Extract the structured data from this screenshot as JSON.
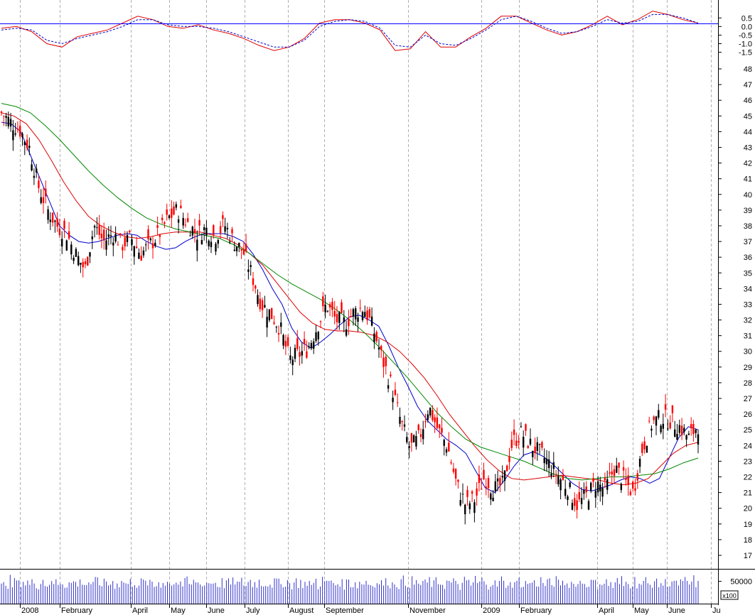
{
  "chart_data": [
    {
      "panel": "oscillator",
      "type": "line",
      "y_ticks": [
        "0.5",
        "0.0",
        "-0.5",
        "-1.0",
        "-1.5"
      ],
      "ylim": [
        -1.6,
        0.8
      ],
      "reference_line": 0,
      "series": [
        {
          "color": "#dd0000",
          "style": "solid",
          "values": [
            -0.1,
            0.0,
            -0.3,
            -1.0,
            -1.2,
            -0.6,
            -0.4,
            -0.2,
            0.2,
            0.6,
            0.4,
            0.0,
            -0.1,
            0.1,
            -0.2,
            -0.4,
            -0.7,
            -1.1,
            -1.4,
            -1.2,
            -0.7,
            0.2,
            0.4,
            0.4,
            0.2,
            -0.2,
            -1.4,
            -1.3,
            -0.3,
            -1.2,
            -1.2,
            -0.6,
            -0.1,
            0.6,
            0.6,
            0.2,
            -0.2,
            -0.5,
            -0.3,
            0.1,
            0.6,
            0.1,
            0.4,
            0.9,
            0.7,
            0.4,
            0.2
          ]
        },
        {
          "color": "#0000cc",
          "style": "dashed",
          "values": [
            -0.2,
            -0.1,
            -0.2,
            -0.8,
            -1.0,
            -0.7,
            -0.5,
            -0.3,
            0.0,
            0.4,
            0.4,
            0.1,
            0.0,
            0.0,
            -0.1,
            -0.3,
            -0.6,
            -0.9,
            -1.2,
            -1.2,
            -0.8,
            0.0,
            0.3,
            0.4,
            0.3,
            -0.1,
            -1.1,
            -1.2,
            -0.5,
            -1.0,
            -1.1,
            -0.7,
            -0.2,
            0.4,
            0.6,
            0.3,
            -0.1,
            -0.4,
            -0.3,
            0.0,
            0.4,
            0.2,
            0.3,
            0.7,
            0.7,
            0.5,
            0.2
          ]
        }
      ]
    },
    {
      "panel": "price",
      "type": "candlestick",
      "y_ticks": [
        "17",
        "18",
        "19",
        "20",
        "21",
        "22",
        "23",
        "24",
        "25",
        "26",
        "27",
        "28",
        "29",
        "30",
        "31",
        "32",
        "33",
        "34",
        "35",
        "36",
        "37",
        "38",
        "39",
        "40",
        "41",
        "42",
        "43",
        "44",
        "45",
        "46",
        "47",
        "48"
      ],
      "ylim": [
        16.4,
        48.5
      ],
      "close": [
        45.2,
        44.6,
        44.1,
        43.0,
        40.5,
        39.0,
        38.0,
        37.5,
        36.2,
        35.2,
        38.0,
        37.0,
        37.5,
        36.8,
        37.2,
        36.2,
        36.8,
        37.5,
        38.5,
        39.0,
        38.2,
        37.5,
        37.8,
        37.3,
        38.1,
        37.0,
        36.4,
        34.8,
        33.0,
        32.4,
        31.5,
        29.5,
        29.8,
        30.2,
        31.6,
        33.0,
        32.0,
        31.8,
        32.5,
        32.8,
        31.5,
        29.5,
        27.8,
        25.5,
        23.8,
        24.5,
        26.5,
        25.0,
        24.0,
        21.5,
        20.2,
        20.6,
        22.0,
        21.2,
        21.5,
        24.2,
        24.8,
        24.0,
        23.5,
        22.8,
        22.0,
        21.3,
        20.2,
        20.8,
        21.6,
        21.2,
        22.6,
        21.8,
        21.0,
        23.8,
        25.4,
        25.8,
        25.6,
        25.2,
        24.5,
        25.3
      ],
      "ma_series": [
        {
          "color": "#0000cc",
          "values": [
            44.6,
            44.5,
            44.0,
            42.5,
            41.0,
            39.5,
            38.0,
            37.4,
            37.0,
            36.9,
            37.0,
            37.2,
            37.4,
            37.5,
            37.4,
            37.0,
            36.7,
            36.5,
            36.6,
            37.0,
            37.3,
            37.5,
            37.5,
            37.5,
            37.3,
            37.0,
            36.2,
            35.2,
            34.0,
            33.0,
            31.5,
            30.6,
            30.2,
            30.6,
            31.1,
            31.7,
            32.2,
            32.3,
            32.0,
            31.6,
            30.4,
            29.0,
            27.8,
            26.5,
            25.6,
            25.0,
            24.4,
            24.0,
            23.5,
            22.4,
            21.3,
            21.0,
            21.8,
            22.7,
            23.4,
            23.6,
            23.3,
            22.8,
            22.2,
            21.6,
            21.2,
            21.1,
            21.3,
            21.5,
            21.8,
            22.0,
            21.9,
            21.6,
            21.9,
            23.2,
            24.5,
            25.2,
            25.0
          ]
        },
        {
          "color": "#dd0000",
          "values": [
            45.2,
            45.0,
            44.5,
            43.5,
            42.2,
            40.8,
            39.6,
            38.6,
            38.0,
            37.6,
            37.3,
            37.2,
            37.3,
            37.5,
            37.6,
            37.6,
            37.6,
            37.4,
            37.2,
            36.8,
            36.2,
            35.5,
            34.5,
            33.5,
            32.5,
            31.8,
            31.4,
            31.3,
            31.3,
            31.2,
            31.0,
            30.6,
            30.0,
            29.2,
            28.3,
            27.2,
            26.0,
            25.0,
            24.0,
            23.1,
            22.4,
            21.9,
            21.8,
            21.9,
            22.0,
            22.1,
            22.0,
            21.9,
            21.8,
            21.6,
            21.5,
            21.6,
            21.9,
            22.7,
            23.5,
            24.0,
            24.2
          ]
        },
        {
          "color": "#008800",
          "values": [
            45.8,
            45.6,
            45.2,
            44.4,
            43.5,
            42.5,
            41.5,
            40.6,
            39.8,
            39.1,
            38.5,
            38.1,
            37.8,
            37.6,
            37.4,
            37.2,
            36.8,
            36.3,
            35.6,
            34.9,
            34.3,
            33.8,
            33.3,
            32.7,
            32.0,
            31.2,
            30.3,
            29.3,
            28.3,
            27.2,
            26.1,
            25.2,
            24.4,
            23.9,
            23.6,
            23.3,
            23.0,
            22.6,
            22.2,
            21.9,
            21.8,
            21.9,
            22.0,
            22.0,
            22.1,
            22.2,
            22.5,
            22.9,
            23.2
          ]
        }
      ]
    },
    {
      "panel": "volume",
      "type": "bar",
      "y_ticks": [
        "50000"
      ],
      "scale_label": "x100",
      "ylim": [
        0,
        70000
      ],
      "values": [
        38000,
        42000,
        50000,
        44000,
        52000,
        40000,
        47000,
        55000,
        43000,
        49000,
        51000,
        45000,
        48000,
        42000,
        46000,
        50000,
        44000,
        41000,
        47000,
        53000,
        45000,
        43000,
        48000,
        42000,
        46000,
        49000,
        44000,
        51000,
        47000,
        42000,
        45000,
        48000,
        43000,
        50000,
        46000,
        44000,
        47000,
        52000,
        45000,
        43000,
        49000,
        46000,
        42000,
        48000,
        51000,
        44000,
        47000,
        45000,
        50000,
        43000,
        46000,
        48000,
        42000,
        49000,
        44000,
        47000,
        51000,
        45000,
        43000,
        48000,
        46000,
        50000,
        44000,
        42000,
        47000,
        49000,
        45000,
        48000,
        43000,
        46000
      ]
    }
  ],
  "x_axis": {
    "months": [
      "2008",
      "February",
      "April",
      "May",
      "June",
      "July",
      "August",
      "September",
      "November",
      "2009",
      "February",
      "April",
      "May",
      "June",
      "Ju"
    ]
  }
}
